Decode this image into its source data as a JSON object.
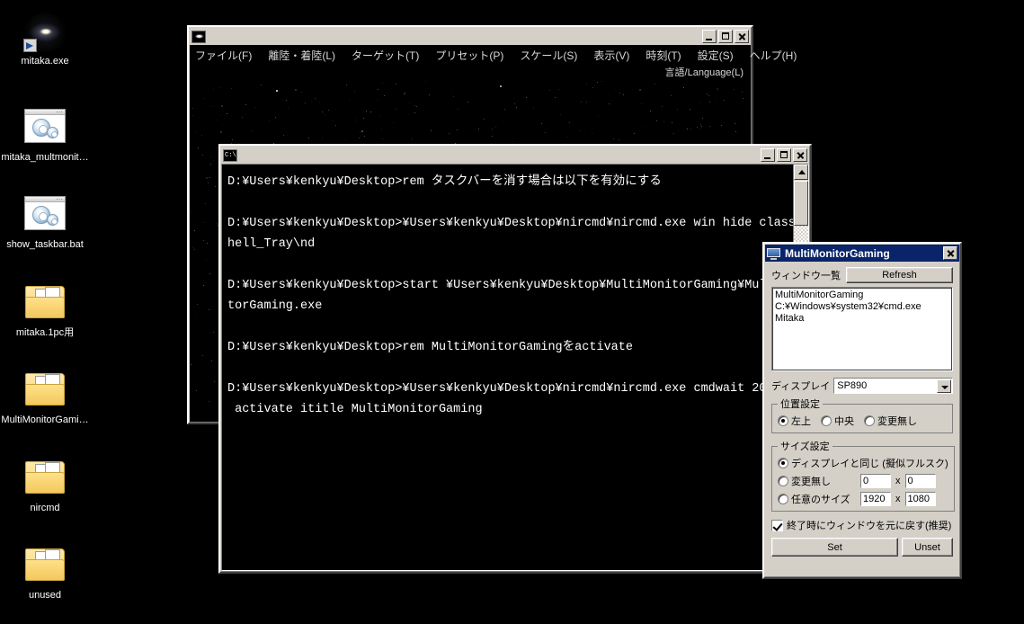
{
  "desktop": {
    "background_color": "#000000",
    "icons": [
      {
        "label": "mitaka.exe",
        "icon": "galaxy-shortcut-icon",
        "type": "shortcut"
      },
      {
        "label": "mitaka_multmonit…",
        "icon": "bat-script-icon",
        "type": "batch"
      },
      {
        "label": "show_taskbar.bat",
        "icon": "bat-script-icon",
        "type": "batch"
      },
      {
        "label": "mitaka.1pc用",
        "icon": "folder-icon",
        "type": "folder"
      },
      {
        "label": "MultiMonitorGami…",
        "icon": "folder-icon",
        "type": "folder"
      },
      {
        "label": "nircmd",
        "icon": "folder-icon",
        "type": "folder"
      },
      {
        "label": "unused",
        "icon": "folder-icon",
        "type": "folder"
      }
    ]
  },
  "mitaka_window": {
    "title": "",
    "titlebar_icon": "galaxy-icon",
    "buttons": {
      "minimize": "_",
      "maximize": "□",
      "close": "×"
    },
    "menu": [
      "ファイル(F)",
      "離陸・着陸(L)",
      "ターゲット(T)",
      "プリセット(P)",
      "スケール(S)",
      "表示(V)",
      "時刻(T)",
      "設定(S)",
      "ヘルプ(H)"
    ],
    "menu_second_row": "言語/Language(L)"
  },
  "cmd_window": {
    "title": "",
    "titlebar_icon": "cmd-icon",
    "buttons": {
      "minimize": "_",
      "maximize": "□",
      "close": "×"
    },
    "console_text": "D:¥Users¥kenkyu¥Desktop>rem タスクバーを消す場合は以下を有効にする\n\nD:¥Users¥kenkyu¥Desktop>¥Users¥kenkyu¥Desktop¥nircmd¥nircmd.exe win hide class S\nhell_Tray\\nd\n\nD:¥Users¥kenkyu¥Desktop>start ¥Users¥kenkyu¥Desktop¥MultiMonitorGaming¥Mult\ntorGaming.exe\n\nD:¥Users¥kenkyu¥Desktop>rem MultiMonitorGamingをactivate\n\nD:¥Users¥kenkyu¥Desktop>¥Users¥kenkyu¥Desktop¥nircmd¥nircmd.exe cmdwait 200\n activate ititle MultiMonitorGaming"
  },
  "mmg_dialog": {
    "title": "MultiMonitorGaming",
    "titlebar_icon": "monitor-icon",
    "close_label": "×",
    "window_list_label": "ウィンドウ一覧",
    "refresh_label": "Refresh",
    "window_list": [
      "MultiMonitorGaming",
      "C:¥Windows¥system32¥cmd.exe",
      "Mitaka"
    ],
    "display_label": "ディスプレイ",
    "display_value": "SP890",
    "position_group_label": "位置設定",
    "position_options": [
      {
        "label": "左上",
        "selected": true
      },
      {
        "label": "中央",
        "selected": false
      },
      {
        "label": "変更無し",
        "selected": false
      }
    ],
    "size_group_label": "サイズ設定",
    "size_options": [
      {
        "label": "ディスプレイと同じ (擬似フルスク)",
        "selected": true
      },
      {
        "label": "変更無し",
        "selected": false,
        "width": "0",
        "height": "0"
      },
      {
        "label": "任意のサイズ",
        "selected": false,
        "width": "1920",
        "height": "1080"
      }
    ],
    "dimension_separator": "x",
    "restore_checkbox": {
      "label": "終了時にウィンドウを元に戻す(推奨)",
      "checked": true
    },
    "set_label": "Set",
    "unset_label": "Unset"
  },
  "colors": {
    "window_face": "#d4d0c8",
    "titlebar_active": "#0a246a",
    "titlebar_inactive": "#d4d0c8",
    "console_bg": "#000000",
    "console_fg": "#ffffff",
    "desktop_bg": "#000000"
  }
}
